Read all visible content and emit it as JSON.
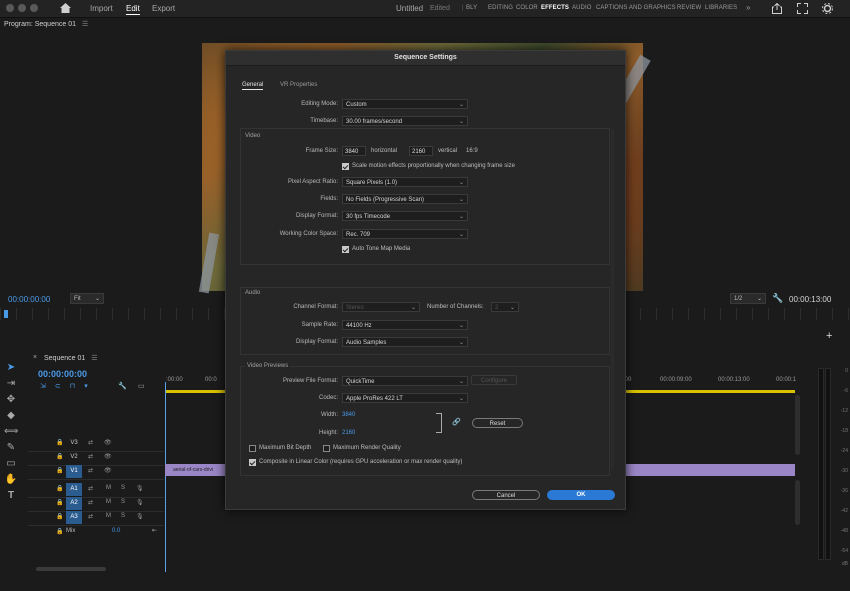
{
  "topbar": {
    "menu": [
      "Import",
      "Edit",
      "Export"
    ],
    "active_menu": "Edit",
    "title": "Untitled",
    "edited": "Edited",
    "workspaces": [
      "BLY",
      "EDITING",
      "COLOR",
      "EFFECTS",
      "AUDIO",
      "CAPTIONS AND GRAPHICS",
      "REVIEW",
      "LIBRARIES"
    ],
    "active_workspace": "EFFECTS"
  },
  "program": {
    "title": "Program: Sequence 01",
    "timecode_left": "00:00:00:00",
    "fit": "Fit",
    "resolution": "1/2",
    "timecode_right": "00:00:13:00"
  },
  "timeline": {
    "tab": "Sequence 01",
    "timecode": "00:00:00:00",
    "ruler_left": ":00:00",
    "ruler_right": [
      "00:00:09:00",
      "00:00:13:00",
      "00:00:1"
    ],
    "tracks": [
      {
        "name": "V3",
        "type": "video"
      },
      {
        "name": "V2",
        "type": "video"
      },
      {
        "name": "V1",
        "type": "video"
      },
      {
        "name": "A1",
        "type": "audio"
      },
      {
        "name": "A2",
        "type": "audio"
      },
      {
        "name": "A3",
        "type": "audio"
      }
    ],
    "mix_label": "Mix",
    "mix_value": "0.0",
    "clip_name": "aerial-of-cars-drivi"
  },
  "meter": {
    "labels": [
      "0",
      "-6",
      "-12",
      "-18",
      "-24",
      "-30",
      "-36",
      "-42",
      "-48",
      "-54",
      "dB"
    ]
  },
  "dialog": {
    "title": "Sequence Settings",
    "tabs": [
      "General",
      "VR Properties"
    ],
    "active_tab": "General",
    "editing_mode_label": "Editing Mode:",
    "editing_mode": "Custom",
    "timebase_label": "Timebase:",
    "timebase": "30.00  frames/second",
    "video_section": "Video",
    "frame_size_label": "Frame Size:",
    "frame_width": "3840",
    "horizontal_label": "horizontal",
    "frame_height": "2160",
    "vertical_label": "vertical",
    "aspect": "16:9",
    "scale_motion": "Scale motion effects proportionally when changing frame size",
    "pixel_aspect_label": "Pixel Aspect Ratio:",
    "pixel_aspect": "Square Pixels (1.0)",
    "fields_label": "Fields:",
    "fields": "No Fields (Progressive Scan)",
    "display_format_label": "Display Format:",
    "display_format": "30 fps Timecode",
    "color_space_label": "Working Color Space:",
    "color_space": "Rec. 709",
    "auto_tone": "Auto Tone Map Media",
    "audio_section": "Audio",
    "channel_format_label": "Channel Format:",
    "channel_format": "Stereo",
    "num_channels_label": "Number of Channels:",
    "num_channels": "2",
    "sample_rate_label": "Sample Rate:",
    "sample_rate": "44100 Hz",
    "audio_display_label": "Display Format:",
    "audio_display": "Audio Samples",
    "previews_section": "Video Previews",
    "preview_format_label": "Preview File Format:",
    "preview_format": "QuickTime",
    "configure": "Configure",
    "codec_label": "Codec:",
    "codec": "Apple ProRes 422 LT",
    "width_label": "Width:",
    "width": "3840",
    "height_label": "Height:",
    "height": "2160",
    "reset": "Reset",
    "max_bit_depth": "Maximum Bit Depth",
    "max_render": "Maximum Render Quality",
    "composite_linear": "Composite in Linear Color (requires GPU acceleration or max render quality)",
    "cancel": "Cancel",
    "ok": "OK"
  }
}
